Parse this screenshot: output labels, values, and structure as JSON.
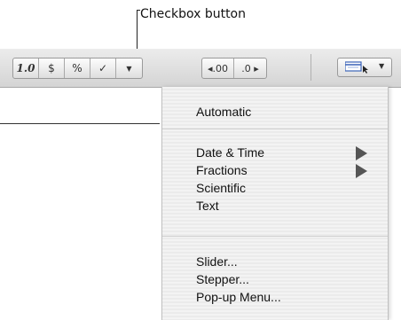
{
  "callout": {
    "text": "Checkbox button"
  },
  "toolbar": {
    "group1": [
      "1.0",
      "$",
      "%",
      "✓",
      "▼"
    ],
    "group2": [
      "◂.00",
      ".0 ▸"
    ]
  },
  "menu": {
    "items": [
      "Automatic",
      "Date & Time",
      "Fractions",
      "Scientific",
      "Text",
      "Slider...",
      "Stepper...",
      "Pop-up Menu..."
    ]
  }
}
